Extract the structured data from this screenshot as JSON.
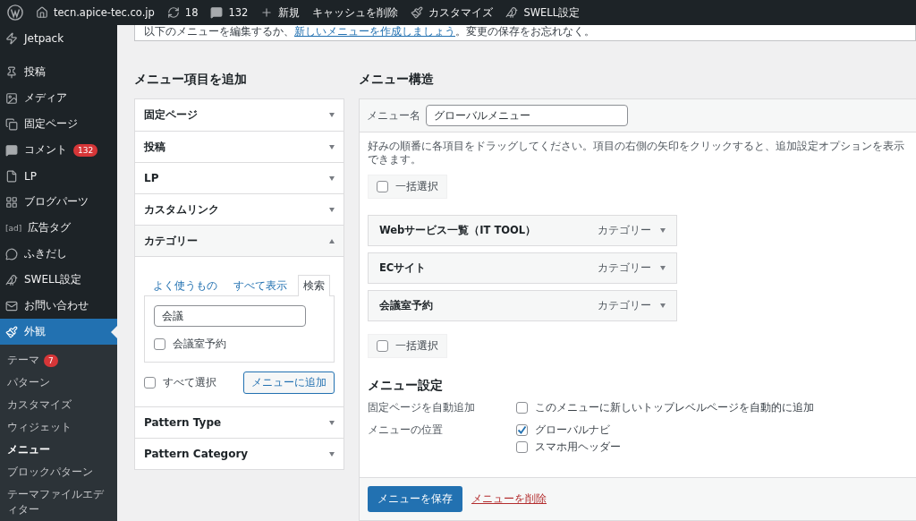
{
  "admin_bar": [
    {
      "kind": "wp"
    },
    {
      "kind": "home",
      "label": "tecn.apice-tec.co.jp"
    },
    {
      "kind": "updates",
      "label": "18"
    },
    {
      "kind": "comments",
      "label": "132"
    },
    {
      "kind": "plus",
      "label": "新規"
    },
    {
      "kind": "text",
      "label": "キャッシュを削除"
    },
    {
      "kind": "brush",
      "label": "カスタマイズ"
    },
    {
      "kind": "bird",
      "label": "SWELL設定"
    }
  ],
  "sidebar": {
    "items": [
      {
        "label": "Jetpack",
        "kind": "jetpack",
        "selected": false
      },
      {
        "label": "投稿",
        "kind": "pin",
        "selected": false
      },
      {
        "label": "メディア",
        "kind": "media",
        "selected": false
      },
      {
        "label": "固定ページ",
        "kind": "pages",
        "selected": false
      },
      {
        "label": "コメント",
        "kind": "comment",
        "badge": "132",
        "selected": false
      },
      {
        "label": "LP",
        "kind": "file",
        "selected": false
      },
      {
        "label": "ブログパーツ",
        "kind": "grid",
        "selected": false
      },
      {
        "label": "広告タグ",
        "kind": "ad",
        "icon_text": "[ad]",
        "selected": false
      },
      {
        "label": "ふきだし",
        "kind": "bubble",
        "selected": false
      },
      {
        "label": "SWELL設定",
        "kind": "bird",
        "selected": false
      },
      {
        "label": "お問い合わせ",
        "kind": "mail",
        "selected": false
      },
      {
        "label": "外観",
        "kind": "brush",
        "selected": true
      }
    ],
    "submenu": [
      {
        "label": "テーマ",
        "badge": "7",
        "selected": false
      },
      {
        "label": "パターン",
        "selected": false
      },
      {
        "label": "カスタマイズ",
        "selected": false
      },
      {
        "label": "ウィジェット",
        "selected": false
      },
      {
        "label": "メニュー",
        "selected": true
      },
      {
        "label": "ブロックパターン",
        "selected": false
      },
      {
        "label": "テーマファイルエディター",
        "selected": false
      }
    ]
  },
  "notice": {
    "before": "以下のメニューを編集するか、",
    "link": "新しいメニューを作成しましょう",
    "after": "。変更の保存をお忘れなく。"
  },
  "add_items": {
    "title": "メニュー項目を追加",
    "sections": [
      {
        "label": "固定ページ",
        "expanded": false
      },
      {
        "label": "投稿",
        "expanded": false
      },
      {
        "label": "LP",
        "expanded": false
      },
      {
        "label": "カスタムリンク",
        "expanded": false
      },
      {
        "label": "カテゴリー",
        "expanded": true,
        "tabs": [
          {
            "label": "よく使うもの",
            "selected": false
          },
          {
            "label": "すべて表示",
            "selected": false
          },
          {
            "label": "検索",
            "selected": true
          }
        ],
        "search_value": "会議",
        "results": [
          {
            "label": "会議室予約",
            "checked": false
          }
        ],
        "select_all": {
          "label": "すべて選択",
          "checked": false
        },
        "add_button": "メニューに追加"
      },
      {
        "label": "Pattern Type",
        "expanded": false
      },
      {
        "label": "Pattern Category",
        "expanded": false
      }
    ]
  },
  "structure": {
    "title": "メニュー構造",
    "name_label": "メニュー名",
    "name_value": "グローバルメニュー",
    "instructions": "好みの順番に各項目をドラッグしてください。項目の右側の矢印をクリックすると、追加設定オプションを表示できます。",
    "bulk_top": {
      "label": "一括選択",
      "checked": false
    },
    "items": [
      {
        "title": "Webサービス一覧（IT TOOL）",
        "type": "カテゴリー"
      },
      {
        "title": "ECサイト",
        "type": "カテゴリー"
      },
      {
        "title": "会議室予約",
        "type": "カテゴリー"
      }
    ],
    "bulk_bottom": {
      "label": "一括選択",
      "checked": false
    },
    "settings": {
      "title": "メニュー設定",
      "auto_add_label": "固定ページを自動追加",
      "auto_add": {
        "label": "このメニューに新しいトップレベルページを自動的に追加",
        "checked": false
      },
      "location_label": "メニューの位置",
      "locations": [
        {
          "label": "グローバルナビ",
          "checked": true
        },
        {
          "label": "スマホ用ヘッダー",
          "checked": false
        }
      ]
    },
    "save_button": "メニューを保存",
    "delete_link": "メニューを削除"
  }
}
